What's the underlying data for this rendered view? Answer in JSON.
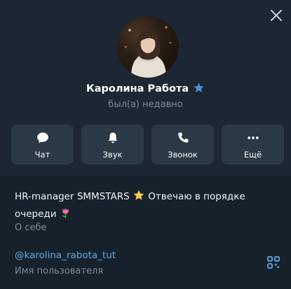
{
  "profile": {
    "name": "Каролина Работа",
    "status": "был(а) недавно",
    "verified_badge_color": "#4d8fd6"
  },
  "actions": [
    {
      "label": "Чат",
      "icon": "chat-bubble-icon"
    },
    {
      "label": "Звук",
      "icon": "bell-icon"
    },
    {
      "label": "Звонок",
      "icon": "phone-icon"
    },
    {
      "label": "Ещё",
      "icon": "more-dots-icon"
    }
  ],
  "bio": {
    "text_part1": "HR-manager SMMSTARS",
    "text_part2": " Отвечаю в порядке очереди",
    "caption": "О себе"
  },
  "username": {
    "value": "@karolina_rabota_tut",
    "caption": "Имя пользователя"
  },
  "colors": {
    "background": "#1c2733",
    "panel": "#17212b",
    "button": "#2b3845",
    "link": "#5fa8e8",
    "muted": "#7c8b99"
  }
}
